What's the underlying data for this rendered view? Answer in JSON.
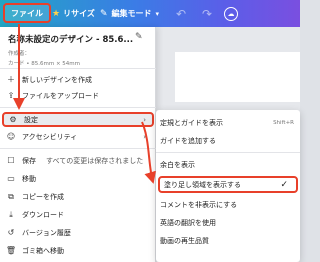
{
  "toolbar": {
    "file_label": "ファイル",
    "resize_label": "リサイズ",
    "edit_mode_label": "編集モード",
    "undo_icon": "undo-icon",
    "redo_icon": "redo-icon",
    "cloud_icon": "cloud-sync-icon"
  },
  "file_menu": {
    "design_title": "名称未設定のデザイン - 85.6...",
    "author": "作成者：",
    "dimensions": "カード • 85.6mm × 54mm",
    "items": [
      {
        "label": "新しいデザインを作成",
        "icon": "plus-icon"
      },
      {
        "label": "ファイルをアップロード",
        "icon": "upload-icon"
      },
      {
        "label": "設定",
        "icon": "settings-icon"
      },
      {
        "label": "アクセシビリティ",
        "icon": "accessibility-icon"
      },
      {
        "label": "保存",
        "icon": "save-icon",
        "note": "すべての変更は保存されました"
      },
      {
        "label": "移動",
        "icon": "folder-icon"
      },
      {
        "label": "コピーを作成",
        "icon": "copy-icon"
      },
      {
        "label": "ダウンロード",
        "icon": "download-icon"
      },
      {
        "label": "バージョン履歴",
        "icon": "history-icon"
      },
      {
        "label": "ゴミ箱へ移動",
        "icon": "trash-icon"
      }
    ]
  },
  "settings_submenu": {
    "items": [
      {
        "label": "定規とガイドを表示",
        "shortcut": "Shift+R"
      },
      {
        "label": "ガイドを追加する"
      },
      {
        "label": "余白を表示"
      },
      {
        "label": "塗り足し領域を表示する",
        "checked": "✓"
      },
      {
        "label": "コメントを非表示にする"
      },
      {
        "label": "英語の翻訳を使用"
      },
      {
        "label": "動画の再生品質"
      }
    ]
  },
  "colors": {
    "highlight": "#e8402a",
    "toolbar_start": "#22a6c4",
    "toolbar_end": "#7a4fe0"
  }
}
